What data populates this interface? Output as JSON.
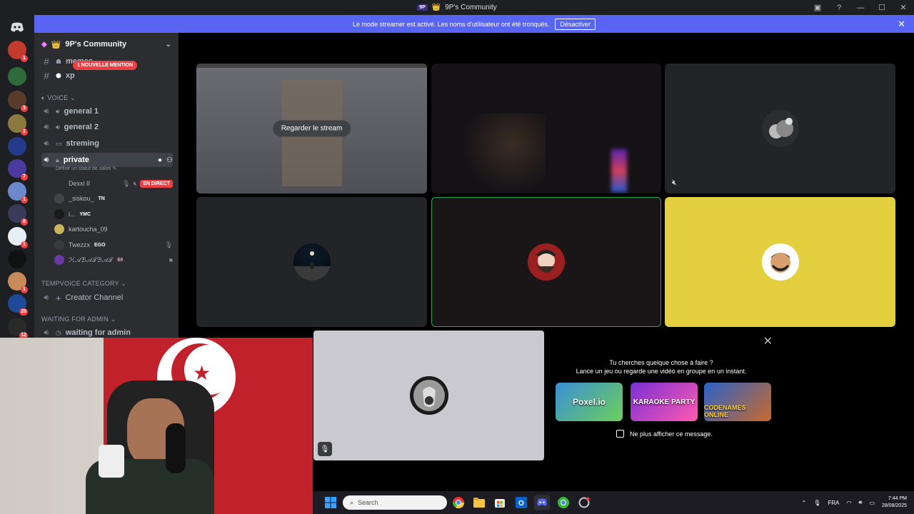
{
  "window": {
    "title": "9P's Community",
    "title_emoji": "👑"
  },
  "banner": {
    "message": "Le mode streamer est activé. Les noms d'utilisateur ont été tronqués.",
    "button_label": "Désactiver"
  },
  "server": {
    "name": "9P's Community",
    "name_emoji": "👑"
  },
  "sidebar": {
    "text_channels": [
      {
        "name": "memes"
      },
      {
        "name": "xp"
      }
    ],
    "mention_pill": "1 NOUVELLE MENTION",
    "voice_category": "VOICE",
    "voice_channels": [
      {
        "name": "general 1"
      },
      {
        "name": "general 2"
      },
      {
        "name": "streming"
      },
      {
        "name": "private"
      }
    ],
    "status_placeholder": "Définir un statut de salon",
    "voice_users": [
      {
        "name": "Dexxi II",
        "tag": "",
        "live": "EN DIRECT"
      },
      {
        "name": "_siskou_",
        "tag": "TN",
        "live": ""
      },
      {
        "name": "i...",
        "tag": "YMC",
        "live": ""
      },
      {
        "name": "kartoucha_09",
        "tag": "",
        "live": ""
      },
      {
        "name": "Twezzx",
        "tag": "EGO",
        "live": ""
      },
      {
        "name": "ℋ𝒜ℬ𝒜𝒯ℬ𝒜𝒯",
        "tag": "69",
        "live": ""
      }
    ],
    "tempvoice_category": "TEMPVOICE CATEGORY",
    "creator_channel": "Creator Channel",
    "waiting_category": "WAITING FOR ADMIN",
    "waiting_channel": "waiting for admin"
  },
  "server_rail": {
    "badges": [
      "1",
      "",
      "3",
      "2",
      "",
      "7",
      "1",
      "8",
      "1",
      "",
      "1",
      "20",
      "12"
    ]
  },
  "stage": {
    "watch_stream_label": "Regarder le stream"
  },
  "activity": {
    "line1": "Tu cherches quelque chose à faire ?",
    "line2": "Lance un jeu ou regarde une vidéo en groupe en un instant.",
    "games": [
      "Poxel.io",
      "KARAOKE PARTY",
      "CODENAMES ONLINE"
    ],
    "dont_show": "Ne plus afficher ce message."
  },
  "taskbar": {
    "search_placeholder": "Search",
    "language": "FRA",
    "time": "7:44 PM",
    "date": "28/08/2025"
  },
  "colors": {
    "banner": "#5865f2",
    "speaking_border": "#23a55a",
    "live_badge": "#f23f43",
    "yellow_tile": "#e4d03f"
  }
}
